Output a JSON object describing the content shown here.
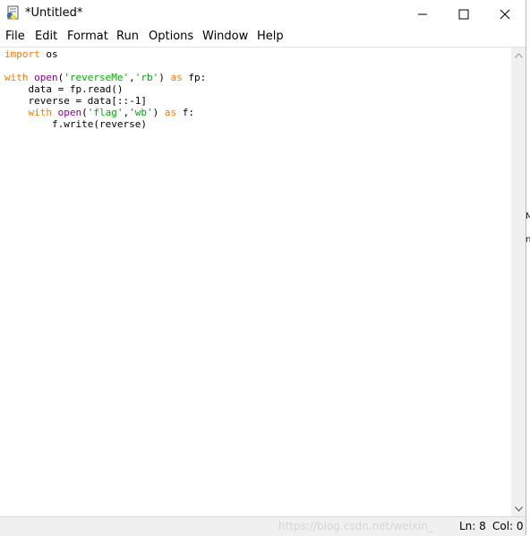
{
  "window": {
    "title": "*Untitled*"
  },
  "menu": [
    "File",
    "Edit",
    "Format",
    "Run",
    "Options",
    "Window",
    "Help"
  ],
  "code": {
    "line1": {
      "kw": "import",
      "rest": " os"
    },
    "line3": {
      "kw1": "with",
      "sp1": " ",
      "bi": "open",
      "p1": "(",
      "s1": "'reverseMe'",
      "comma": ",",
      "s2": "'rb'",
      "p2": ") ",
      "kw2": "as",
      "rest": " fp:"
    },
    "line4": "    data = fp.read()",
    "line5": "    reverse = data[::-1]",
    "line6": {
      "indent": "    ",
      "kw1": "with",
      "sp1": " ",
      "bi": "open",
      "p1": "(",
      "s1": "'flag'",
      "comma": ",",
      "s2": "'wb'",
      "p2": ") ",
      "kw2": "as",
      "rest": " f:"
    },
    "line7": "        f.write(reverse)"
  },
  "status": {
    "ln": "Ln: 8",
    "col": "Col: 0",
    "watermark": "https://blog.csdn.net/weixin_"
  },
  "background_fragments": [
    "M",
    "n"
  ],
  "colors": {
    "keyword": "#ff7700",
    "builtin": "#900090",
    "string": "#00aa00"
  },
  "icons": [
    "idle-app-icon",
    "minimize-icon",
    "maximize-icon",
    "close-icon",
    "scroll-up-arrow-icon",
    "scroll-down-arrow-icon"
  ]
}
